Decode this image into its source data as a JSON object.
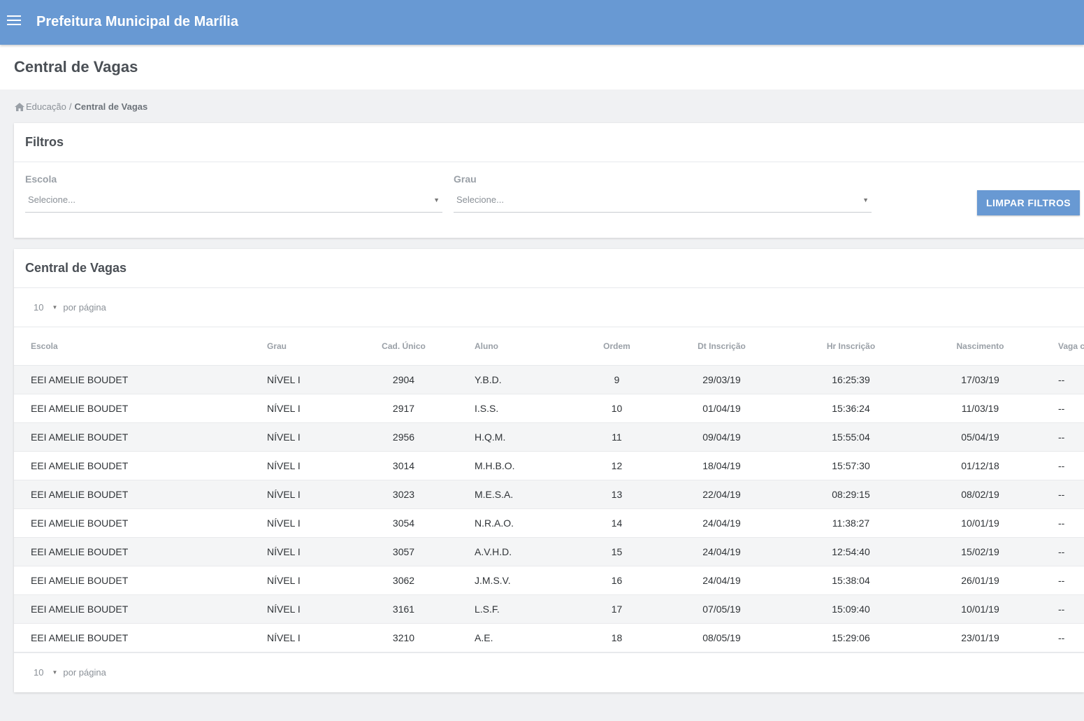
{
  "app": {
    "title": "Prefeitura Municipal de Marília",
    "menu_icon": "hamburger-menu-icon"
  },
  "page": {
    "title": "Central de Vagas"
  },
  "breadcrumb": {
    "home_icon": "home-icon",
    "parent": "Educação",
    "separator": "/",
    "current": "Central de Vagas"
  },
  "filters": {
    "title": "Filtros",
    "school": {
      "label": "Escola",
      "placeholder": "Selecione..."
    },
    "grade": {
      "label": "Grau",
      "placeholder": "Selecione..."
    },
    "clear_button": "LIMPAR FILTROS"
  },
  "table_card": {
    "title": "Central de Vagas",
    "per_page_value": "10",
    "per_page_label": "por página",
    "columns": [
      "Escola",
      "Grau",
      "Cad. Único",
      "Aluno",
      "Ordem",
      "Dt Inscrição",
      "Hr Inscrição",
      "Nascimento",
      "Vaga co"
    ],
    "rows": [
      [
        "EEI AMELIE BOUDET",
        "NÍVEL I",
        "2904",
        "Y.B.D.",
        "9",
        "29/03/19",
        "16:25:39",
        "17/03/19",
        "--"
      ],
      [
        "EEI AMELIE BOUDET",
        "NÍVEL I",
        "2917",
        "I.S.S.",
        "10",
        "01/04/19",
        "15:36:24",
        "11/03/19",
        "--"
      ],
      [
        "EEI AMELIE BOUDET",
        "NÍVEL I",
        "2956",
        "H.Q.M.",
        "11",
        "09/04/19",
        "15:55:04",
        "05/04/19",
        "--"
      ],
      [
        "EEI AMELIE BOUDET",
        "NÍVEL I",
        "3014",
        "M.H.B.O.",
        "12",
        "18/04/19",
        "15:57:30",
        "01/12/18",
        "--"
      ],
      [
        "EEI AMELIE BOUDET",
        "NÍVEL I",
        "3023",
        "M.E.S.A.",
        "13",
        "22/04/19",
        "08:29:15",
        "08/02/19",
        "--"
      ],
      [
        "EEI AMELIE BOUDET",
        "NÍVEL I",
        "3054",
        "N.R.A.O.",
        "14",
        "24/04/19",
        "11:38:27",
        "10/01/19",
        "--"
      ],
      [
        "EEI AMELIE BOUDET",
        "NÍVEL I",
        "3057",
        "A.V.H.D.",
        "15",
        "24/04/19",
        "12:54:40",
        "15/02/19",
        "--"
      ],
      [
        "EEI AMELIE BOUDET",
        "NÍVEL I",
        "3062",
        "J.M.S.V.",
        "16",
        "24/04/19",
        "15:38:04",
        "26/01/19",
        "--"
      ],
      [
        "EEI AMELIE BOUDET",
        "NÍVEL I",
        "3161",
        "L.S.F.",
        "17",
        "07/05/19",
        "15:09:40",
        "10/01/19",
        "--"
      ],
      [
        "EEI AMELIE BOUDET",
        "NÍVEL I",
        "3210",
        "A.E.",
        "18",
        "08/05/19",
        "15:29:06",
        "23/01/19",
        "--"
      ]
    ]
  },
  "colors": {
    "primary": "#6899d3",
    "background": "#f0f1f3"
  }
}
